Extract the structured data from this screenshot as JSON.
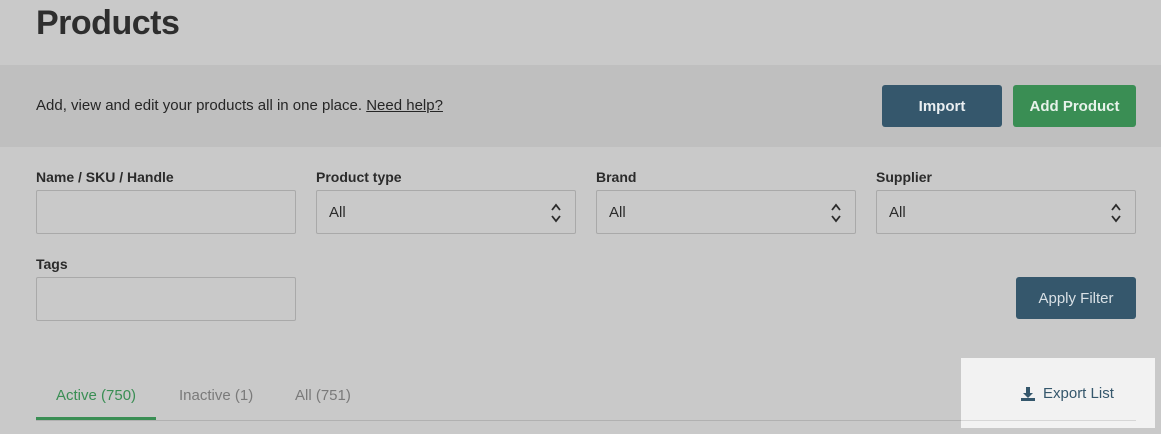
{
  "header": {
    "title": "Products"
  },
  "info": {
    "description": "Add, view and edit your products all in one place.",
    "help_link": "Need help?",
    "import_label": "Import",
    "add_product_label": "Add Product"
  },
  "filters": {
    "name_label": "Name / SKU / Handle",
    "name_value": "",
    "product_type_label": "Product type",
    "product_type_value": "All",
    "brand_label": "Brand",
    "brand_value": "All",
    "supplier_label": "Supplier",
    "supplier_value": "All",
    "tags_label": "Tags",
    "tags_value": "",
    "apply_label": "Apply Filter"
  },
  "tabs": [
    {
      "label": "Active (750)",
      "active": true
    },
    {
      "label": "Inactive (1)",
      "active": false
    },
    {
      "label": "All (751)",
      "active": false
    }
  ],
  "export": {
    "label": "Export List",
    "icon": "download-icon"
  },
  "colors": {
    "primary": "#35576c",
    "accent": "#3a8e54"
  }
}
